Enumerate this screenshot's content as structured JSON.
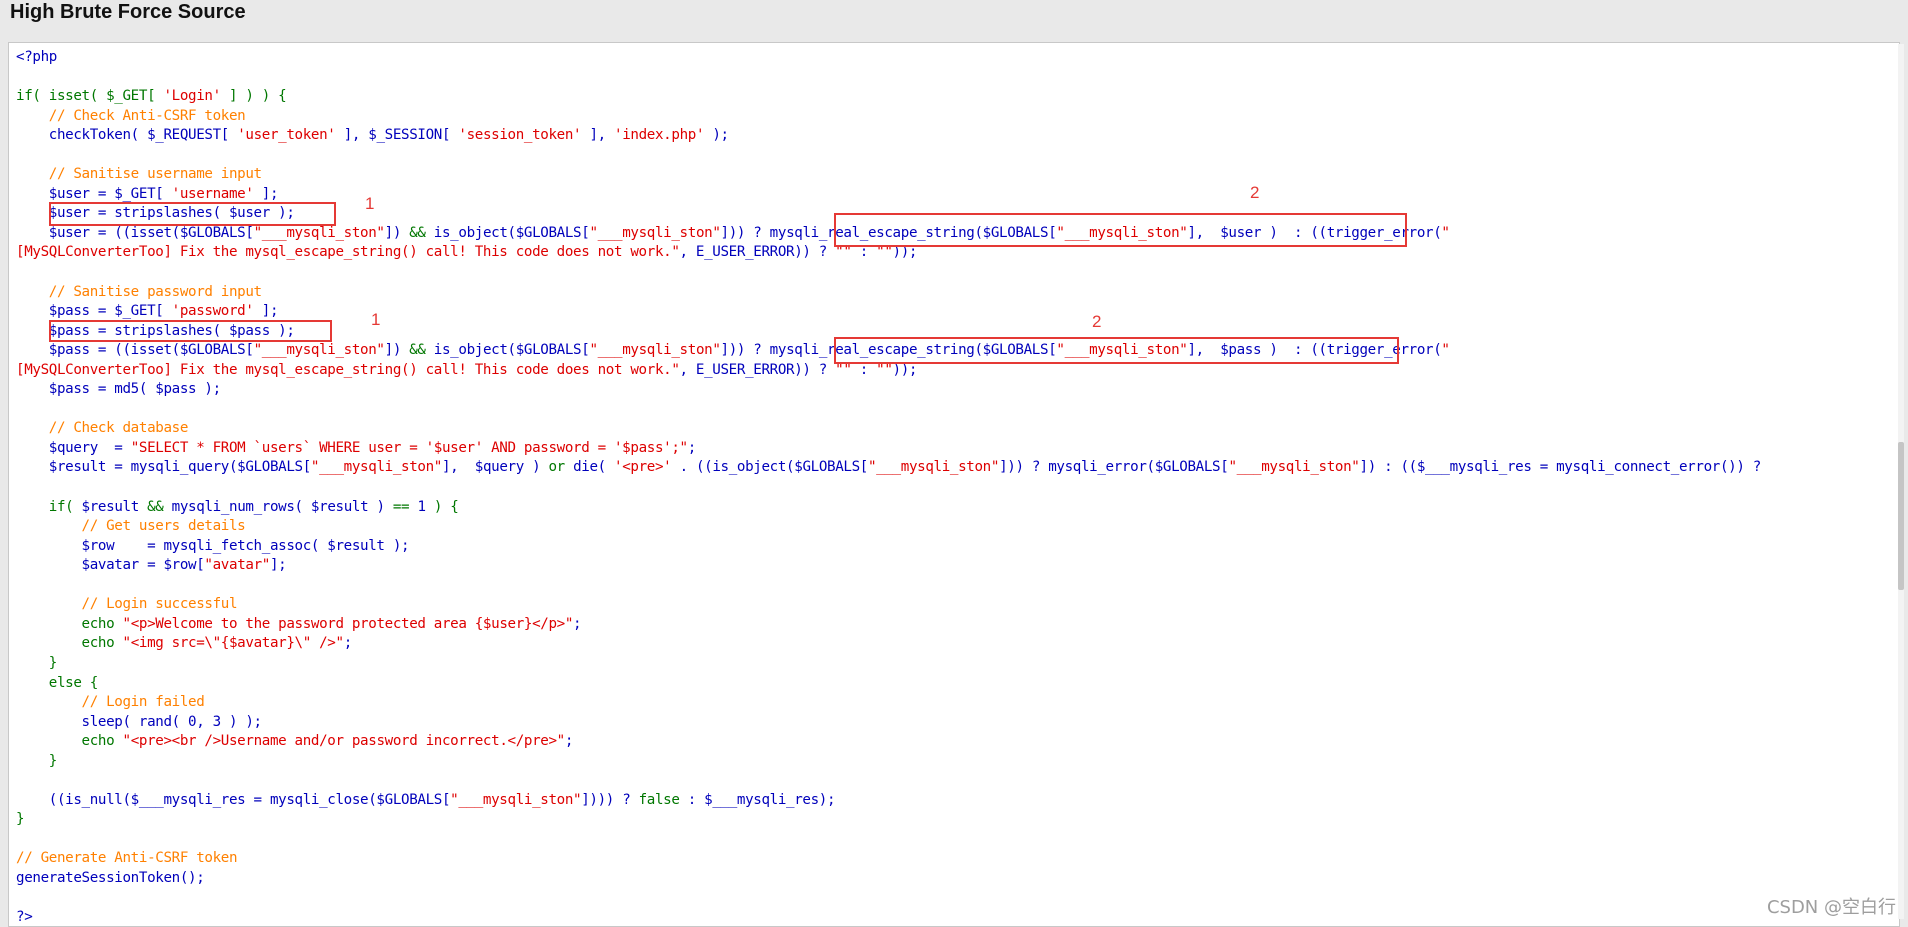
{
  "page": {
    "title": "High Brute Force Source",
    "watermark": "CSDN @空白行"
  },
  "annotations": {
    "marker_user_1": "1",
    "marker_user_2": "2",
    "marker_pass_1": "1",
    "marker_pass_2": "2",
    "box_color": "#e53935"
  },
  "code": {
    "lines": [
      [
        [
          "",
          "<?php"
        ]
      ],
      [],
      [
        [
          "k",
          "if( isset( $_GET[ "
        ],
        [
          "s",
          "'Login'"
        ],
        [
          "k",
          " ] ) ) {"
        ]
      ],
      [
        [
          "c",
          "    // Check Anti-CSRF token"
        ]
      ],
      [
        [
          "",
          "    checkToken( $_REQUEST[ "
        ],
        [
          "s",
          "'user_token'"
        ],
        [
          "",
          " ], $_SESSION[ "
        ],
        [
          "s",
          "'session_token'"
        ],
        [
          "",
          " ], "
        ],
        [
          "s",
          "'index.php'"
        ],
        [
          "",
          " );"
        ]
      ],
      [],
      [
        [
          "c",
          "    // Sanitise username input"
        ]
      ],
      [
        [
          "",
          "    $user = $_GET[ "
        ],
        [
          "s",
          "'username'"
        ],
        [
          "",
          " ];"
        ]
      ],
      [
        [
          "",
          "    $user = stripslashes( $user );"
        ]
      ],
      [
        [
          "",
          "    $user = ((isset($GLOBALS["
        ],
        [
          "s",
          "\"___mysqli_ston\""
        ],
        [
          "",
          "]) "
        ],
        [
          "k",
          "&&"
        ],
        [
          "",
          " is_object($GLOBALS["
        ],
        [
          "s",
          "\"___mysqli_ston\""
        ],
        [
          "",
          "])) ? mysqli_real_escape_string($GLOBALS["
        ],
        [
          "s",
          "\"___mysqli_ston\""
        ],
        [
          "",
          "],  $user )  : ((trigger_error("
        ],
        [
          "s",
          "\""
        ]
      ],
      [
        [
          "s",
          "[MySQLConverterToo] Fix the mysql_escape_string() call! This code does not work.\""
        ],
        [
          "",
          ", E_USER_ERROR)) ? "
        ],
        [
          "s",
          "\"\""
        ],
        [
          "",
          " : "
        ],
        [
          "s",
          "\"\""
        ],
        [
          "",
          "));"
        ]
      ],
      [],
      [
        [
          "c",
          "    // Sanitise password input"
        ]
      ],
      [
        [
          "",
          "    $pass = $_GET[ "
        ],
        [
          "s",
          "'password'"
        ],
        [
          "",
          " ];"
        ]
      ],
      [
        [
          "",
          "    $pass = stripslashes( $pass );"
        ]
      ],
      [
        [
          "",
          "    $pass = ((isset($GLOBALS["
        ],
        [
          "s",
          "\"___mysqli_ston\""
        ],
        [
          "",
          "]) "
        ],
        [
          "k",
          "&&"
        ],
        [
          "",
          " is_object($GLOBALS["
        ],
        [
          "s",
          "\"___mysqli_ston\""
        ],
        [
          "",
          "])) ? mysqli_real_escape_string($GLOBALS["
        ],
        [
          "s",
          "\"___mysqli_ston\""
        ],
        [
          "",
          "],  $pass )  : ((trigger_error("
        ],
        [
          "s",
          "\""
        ]
      ],
      [
        [
          "s",
          "[MySQLConverterToo] Fix the mysql_escape_string() call! This code does not work.\""
        ],
        [
          "",
          ", E_USER_ERROR)) ? "
        ],
        [
          "s",
          "\"\""
        ],
        [
          "",
          " : "
        ],
        [
          "s",
          "\"\""
        ],
        [
          "",
          "));"
        ]
      ],
      [
        [
          "",
          "    $pass = md5( $pass );"
        ]
      ],
      [],
      [
        [
          "c",
          "    // Check database"
        ]
      ],
      [
        [
          "",
          "    $query  = "
        ],
        [
          "s",
          "\"SELECT * FROM `users` WHERE user = '$user' AND password = '$pass';\""
        ],
        [
          "",
          ";"
        ]
      ],
      [
        [
          "",
          "    $result = mysqli_query($GLOBALS["
        ],
        [
          "s",
          "\"___mysqli_ston\""
        ],
        [
          "",
          "],  $query ) "
        ],
        [
          "k",
          "or"
        ],
        [
          "",
          " die( "
        ],
        [
          "s",
          "'<pre>'"
        ],
        [
          "",
          " . ((is_object($GLOBALS["
        ],
        [
          "s",
          "\"___mysqli_ston\""
        ],
        [
          "",
          "])) ? mysqli_error($GLOBALS["
        ],
        [
          "s",
          "\"___mysqli_ston\""
        ],
        [
          "",
          "]) : (($___mysqli_res = mysqli_connect_error()) ?"
        ]
      ],
      [],
      [
        [
          "k",
          "    if( "
        ],
        [
          "",
          "$result "
        ],
        [
          "k",
          "&&"
        ],
        [
          "",
          " mysqli_num_rows( $result ) "
        ],
        [
          "k",
          "== "
        ],
        [
          "",
          "1"
        ],
        [
          "k",
          " ) {"
        ]
      ],
      [
        [
          "c",
          "        // Get users details"
        ]
      ],
      [
        [
          "",
          "        $row    = mysqli_fetch_assoc( $result );"
        ]
      ],
      [
        [
          "",
          "        $avatar = $row["
        ],
        [
          "s",
          "\"avatar\""
        ],
        [
          "",
          "];"
        ]
      ],
      [],
      [
        [
          "c",
          "        // Login successful"
        ]
      ],
      [
        [
          "k",
          "        echo "
        ],
        [
          "s",
          "\"<p>Welcome to the password protected area {$user}</p>\""
        ],
        [
          "",
          ";"
        ]
      ],
      [
        [
          "k",
          "        echo "
        ],
        [
          "s",
          "\"<img src=\\\"{$avatar}\\\" />\""
        ],
        [
          "",
          ";"
        ]
      ],
      [
        [
          "k",
          "    }"
        ]
      ],
      [
        [
          "k",
          "    else {"
        ]
      ],
      [
        [
          "c",
          "        // Login failed"
        ]
      ],
      [
        [
          "",
          "        sleep( rand( 0, 3 ) );"
        ]
      ],
      [
        [
          "k",
          "        echo "
        ],
        [
          "s",
          "\"<pre><br />Username and/or password incorrect.</pre>\""
        ],
        [
          "",
          ";"
        ]
      ],
      [
        [
          "k",
          "    }"
        ]
      ],
      [],
      [
        [
          "",
          "    ((is_null($___mysqli_res = mysqli_close($GLOBALS["
        ],
        [
          "s",
          "\"___mysqli_ston\""
        ],
        [
          "",
          "]))) ? "
        ],
        [
          "k",
          "false"
        ],
        [
          "",
          " : $___mysqli_res);"
        ]
      ],
      [
        [
          "k",
          "}"
        ]
      ],
      [],
      [
        [
          "c",
          "// Generate Anti-CSRF token"
        ]
      ],
      [
        [
          "",
          "generateSessionToken();"
        ]
      ],
      [],
      [
        [
          "",
          "?>"
        ]
      ]
    ]
  }
}
